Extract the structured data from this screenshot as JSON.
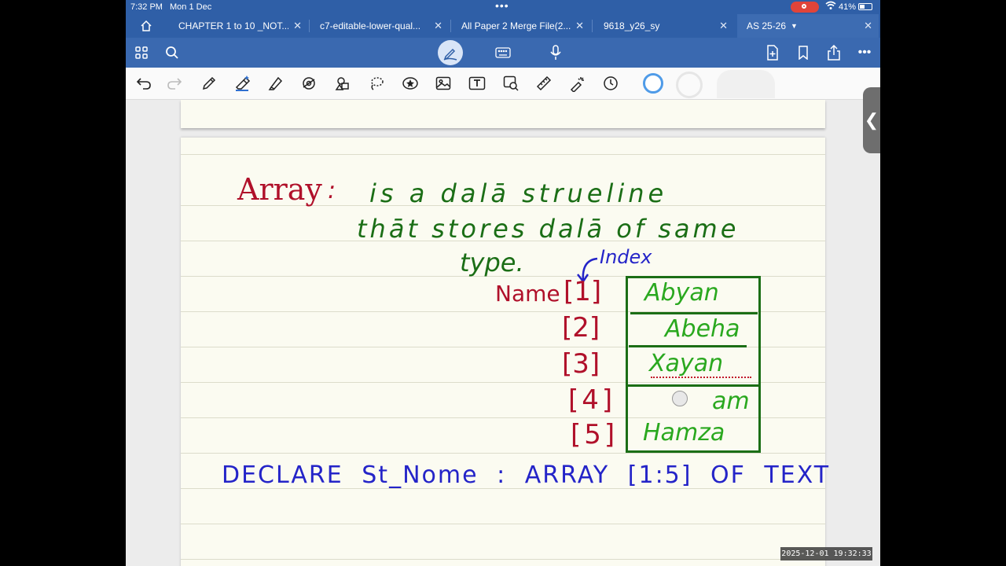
{
  "status": {
    "time": "7:32 PM",
    "date": "Mon 1 Dec",
    "battery": "41%"
  },
  "tabs": [
    {
      "label": "CHAPTER 1 to 10 _NOT...",
      "active": false
    },
    {
      "label": "c7-editable-lower-qual...",
      "active": false
    },
    {
      "label": "All Paper 2 Merge File(2...",
      "active": false
    },
    {
      "label": "9618_y26_sy",
      "active": false
    },
    {
      "label": "AS 25-26",
      "active": true
    }
  ],
  "note": {
    "term": "Array",
    "colon": ":",
    "line1": "is a dalā strueline",
    "line2": "thāt stores dalā of same",
    "line3": "type.",
    "index_label": "Index",
    "name_label": "Name",
    "indices": [
      "[1]",
      "[2]",
      "[3]",
      "[4]",
      "[5]"
    ],
    "values": [
      "Abyan",
      "Abeha",
      "Xayan",
      "am",
      "Hamza"
    ],
    "declare": "DECLARE St_Nome : ARRAY [1:5] OF TEXT"
  },
  "colors": {
    "red_ink": "#b0102a",
    "green_ink": "#1b6e16",
    "bright_green": "#2aa81f",
    "blue_ink": "#2424c8",
    "tabbar": "#2f5fa7"
  },
  "timestamp": "2025-12-01  19:32:33"
}
